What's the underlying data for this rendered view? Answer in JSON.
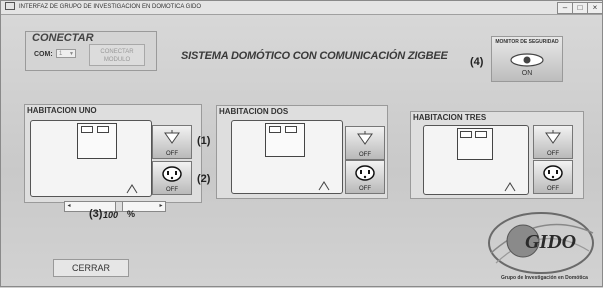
{
  "window": {
    "title": "INTERFAZ DE GRUPO DE INVESTIGACION EN DOMOTICA GIDO"
  },
  "connect": {
    "title": "CONECTAR",
    "com_label": "COM:",
    "com_value": "1",
    "button_label": "CONECTAR MODULO"
  },
  "main_title": "SISTEMA DOMÓTICO CON COMUNICACIÓN ZIGBEE",
  "monitor": {
    "title": "MONITOR DE SEGURIDAD",
    "state": "ON"
  },
  "annotations": {
    "a1": "(1)",
    "a2": "(2)",
    "a3": "(3)",
    "a4": "(4)"
  },
  "rooms": [
    {
      "title": "HABITACION UNO",
      "light_state": "OFF",
      "outlet_state": "OFF"
    },
    {
      "title": "HABITACION DOS",
      "light_state": "OFF",
      "outlet_state": "OFF"
    },
    {
      "title": "HABITACION TRES",
      "light_state": "OFF",
      "outlet_state": "OFF"
    }
  ],
  "dimmer": {
    "value": "100",
    "unit": "%",
    "level_fraction": 0.55
  },
  "close_button": "CERRAR",
  "logo": {
    "text": "GIDO",
    "caption": "Grupo de Investigación en Domótica"
  }
}
